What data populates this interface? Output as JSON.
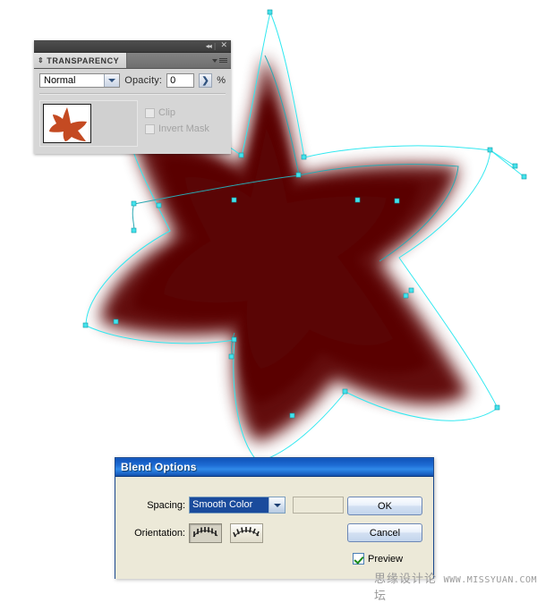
{
  "application": {
    "canvas_background": "#ffffff"
  },
  "artwork": {
    "name": "starfish-blend",
    "fill_color": "#5a0505",
    "blur_edge_color": "#ffffff",
    "path_color": "#32e8f0",
    "anchor_fill": "#45e2ec"
  },
  "transparency_panel": {
    "title": "TRANSPARENCY",
    "window_controls": {
      "collapse": "◂◂",
      "separator": "|",
      "close": "✕"
    },
    "blend_mode": {
      "value": "Normal",
      "dropdown_icon": "chevron-down-icon"
    },
    "opacity": {
      "label": "Opacity:",
      "value": "0",
      "unit": "%",
      "stepper_icon": "chevron-right-icon"
    },
    "mask": {
      "thumbnail_alt": "starfish-thumbnail",
      "clip_label": "Clip",
      "clip_checked": false,
      "invert_mask_label": "Invert Mask",
      "invert_mask_checked": false
    },
    "menu_icon": "panel-menu-icon"
  },
  "blend_options_dialog": {
    "title": "Blend Options",
    "spacing": {
      "label": "Spacing:",
      "value": "Smooth Color",
      "steps_value": "",
      "dropdown_icon": "chevron-down-icon"
    },
    "orientation": {
      "label": "Orientation:",
      "align_to_page_icon": "align-to-page-icon",
      "align_to_path_icon": "align-to-path-icon",
      "selected": "align-to-page"
    },
    "buttons": {
      "ok": "OK",
      "cancel": "Cancel"
    },
    "preview": {
      "label": "Preview",
      "checked": true
    }
  },
  "watermark": {
    "chinese": "思缘设计论坛",
    "url": "WWW.MISSYUAN.COM"
  }
}
